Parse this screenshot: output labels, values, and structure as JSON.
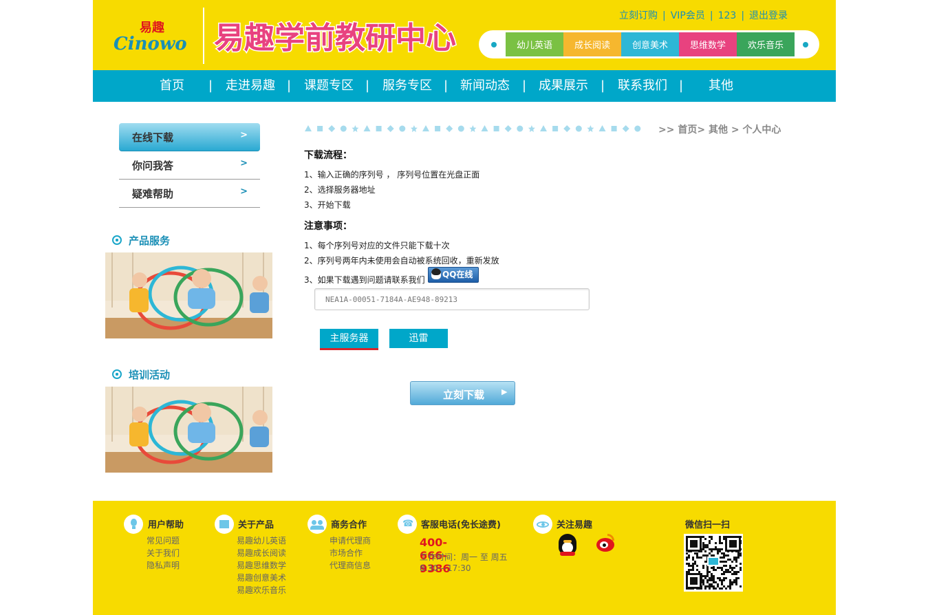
{
  "header": {
    "top_links": [
      "立刻订购",
      "VIP会员",
      "123",
      "退出登录"
    ],
    "categories": [
      {
        "label": "幼儿英语",
        "color": "#7ac143"
      },
      {
        "label": "成长阅读",
        "color": "#f6b72e"
      },
      {
        "label": "创意美术",
        "color": "#2db7d6"
      },
      {
        "label": "思维数学",
        "color": "#e8427f"
      },
      {
        "label": "欢乐音乐",
        "color": "#3aa55b"
      }
    ],
    "logo_text": "易趣学前教研中心",
    "logo_small_text": "易趣",
    "logo_small_sub": "Cinowo"
  },
  "nav": {
    "items": [
      "首页",
      "走进易趣",
      "课题专区",
      "服务专区",
      "新闻动态",
      "成果展示",
      "联系我们",
      "其他"
    ],
    "separator": "|"
  },
  "sidebar": {
    "items": [
      {
        "label": "在线下载",
        "arrow": ">"
      },
      {
        "label": "你问我答",
        "arrow": ">"
      },
      {
        "label": "疑难帮助",
        "arrow": ">"
      }
    ],
    "sections": [
      "产品服务",
      "培训活动"
    ]
  },
  "breadcrumb": {
    "prefix": ">>",
    "items": [
      "首页",
      "其他",
      "个人中心"
    ],
    "sep": ">"
  },
  "main": {
    "flow_title": "下载流程：",
    "flow_items": [
      "1、输入正确的序列号 ， 序列号位置在光盘正面",
      "2、选择服务器地址",
      "3、开始下载"
    ],
    "notes_title": "注意事项：",
    "notes_items": [
      "1、每个序列号对应的文件只能下载十次",
      "2、序列号两年内未使用会自动被系统回收，重新发放",
      "3、如果下载遇到问题请联系我们"
    ],
    "qq_label": "QQ在线",
    "serial_value": "NEA1A-00051-7184A-AE948-89213",
    "servers": [
      "主服务器",
      "迅雷"
    ],
    "download_label": "立刻下载",
    "download_arrow": "▶"
  },
  "footer": {
    "help": {
      "title": "用户帮助",
      "links": [
        "常见问题",
        "关于我们",
        "隐私声明"
      ]
    },
    "products": {
      "title": "关于产品",
      "links": [
        "易趣幼儿英语",
        "易趣成长阅读",
        "易趣思维数学",
        "易趣创意美术",
        "易趣欢乐音乐"
      ]
    },
    "business": {
      "title": "商务合作",
      "links": [
        "申请代理商",
        "市场合作",
        "代理商信息"
      ]
    },
    "service": {
      "title": "客服电话(免长途费)",
      "phone": "400-666-9386",
      "hours1": "工作时间：周一 至 周五",
      "hours2": "8:30---17:30"
    },
    "follow": {
      "title": "关注易趣"
    },
    "wechat": {
      "title": "微信扫一扫"
    }
  },
  "colors": {
    "brand_yellow": "#f7db00",
    "brand_blue": "#00a7c9",
    "accent_red": "#e0161d"
  }
}
